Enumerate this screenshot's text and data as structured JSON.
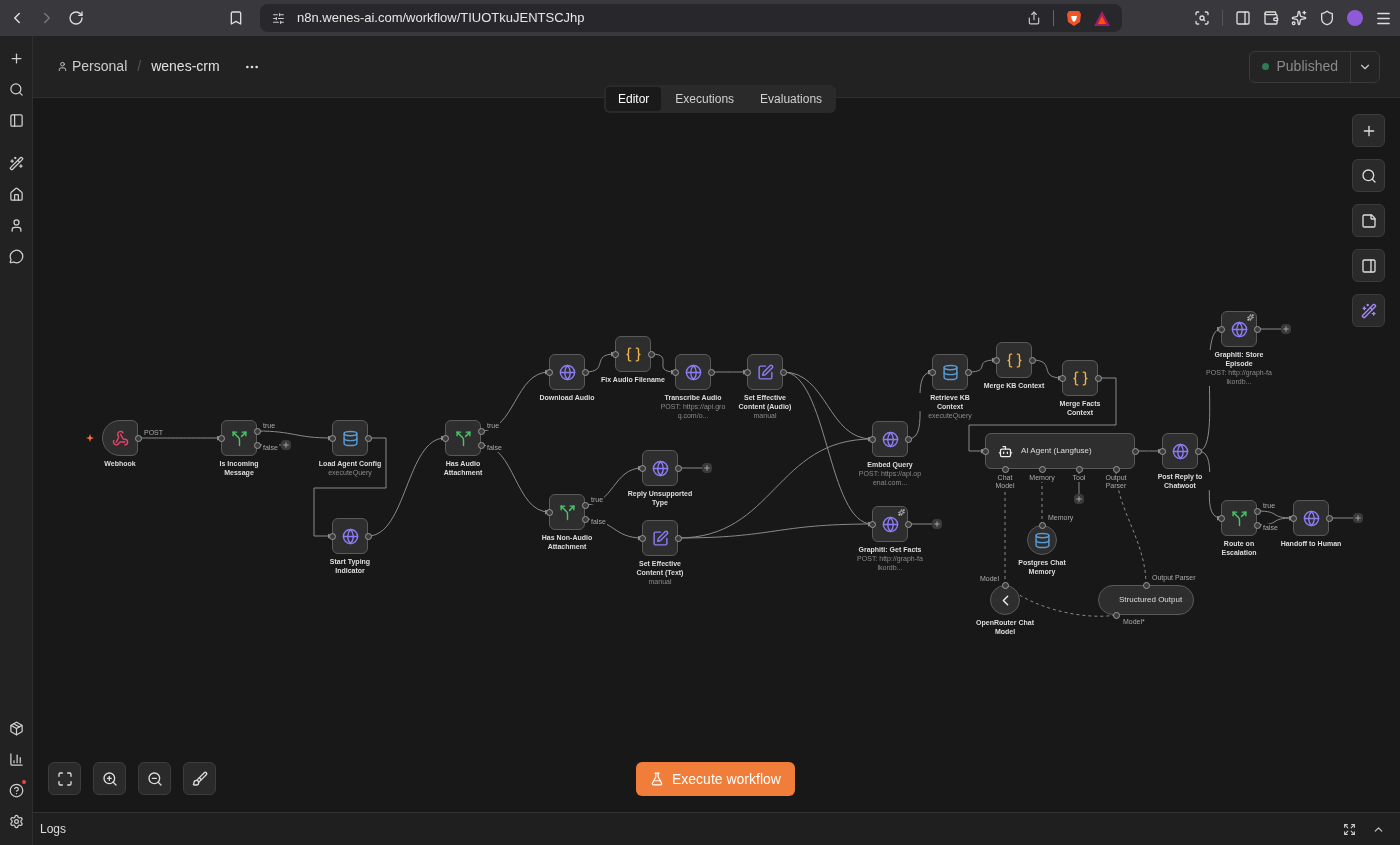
{
  "browser": {
    "url": "n8n.wenes-ai.com/workflow/TIUOTkuJENTSCJhp"
  },
  "breadcrumb": {
    "project": "Personal",
    "separator": "/",
    "workflow": "wenes-crm"
  },
  "tabs": [
    {
      "label": "Editor",
      "selected": true
    },
    {
      "label": "Executions",
      "selected": false
    },
    {
      "label": "Evaluations",
      "selected": false
    }
  ],
  "publish": {
    "label": "Published",
    "disabled": true
  },
  "nodes": [
    {
      "label": "Webhook",
      "kind": "trigger",
      "outputs": [
        "POST"
      ]
    },
    {
      "label": "Is Incoming Message",
      "kind": "if",
      "outputs": [
        "true",
        "false"
      ]
    },
    {
      "label": "Load Agent Config",
      "sublabel": "executeQuery",
      "kind": "postgres"
    },
    {
      "label": "Start Typing Indicator",
      "kind": "http"
    },
    {
      "label": "Has Audio Attachment",
      "kind": "if",
      "outputs": [
        "true",
        "false"
      ]
    },
    {
      "label": "Download Audio",
      "kind": "http"
    },
    {
      "label": "Fix Audio Filename",
      "kind": "code"
    },
    {
      "label": "Transcribe Audio",
      "sublabel": "POST: https://api.groq.com/o...",
      "kind": "http"
    },
    {
      "label": "Set Effective Content (Audio)",
      "sublabel": "manual",
      "kind": "set"
    },
    {
      "label": "Has Non-Audio Attachment",
      "kind": "if",
      "outputs": [
        "true",
        "false"
      ]
    },
    {
      "label": "Reply Unsupported Type",
      "kind": "http"
    },
    {
      "label": "Set Effective Content (Text)",
      "sublabel": "manual",
      "kind": "set"
    },
    {
      "label": "Embed Query",
      "sublabel": "POST: https://api.openai.com...",
      "kind": "http"
    },
    {
      "label": "Graphiti: Get Facts",
      "sublabel": "POST: http://graph-falkordb...",
      "kind": "http",
      "badge": true
    },
    {
      "label": "Retrieve KB Context",
      "sublabel": "executeQuery",
      "kind": "postgres"
    },
    {
      "label": "Merge KB Context",
      "kind": "code"
    },
    {
      "label": "Merge Facts Context",
      "kind": "code"
    },
    {
      "label": "AI Agent (Langfuse)",
      "kind": "agent",
      "ports": [
        "Chat Model",
        "Memory",
        "Tool",
        "Output Parser"
      ]
    },
    {
      "label": "Post Reply to Chatwoot",
      "kind": "http"
    },
    {
      "label": "Postgres Chat Memory",
      "kind": "memory",
      "port_label": "Memory"
    },
    {
      "label": "OpenRouter Chat Model",
      "kind": "model",
      "port_label": "Model"
    },
    {
      "label": "Structured Output",
      "kind": "parser",
      "port_label": "Output Parser",
      "bottom_label": "Model*"
    },
    {
      "label": "Graphiti: Store Episode",
      "sublabel": "POST: http://graph-falkordb...",
      "kind": "http",
      "badge": true
    },
    {
      "label": "Route on Escalation",
      "kind": "if",
      "outputs": [
        "true",
        "false"
      ]
    },
    {
      "label": "Handoff to Human",
      "kind": "http"
    }
  ],
  "execute_button": "Execute workflow",
  "logs": {
    "title": "Logs"
  }
}
